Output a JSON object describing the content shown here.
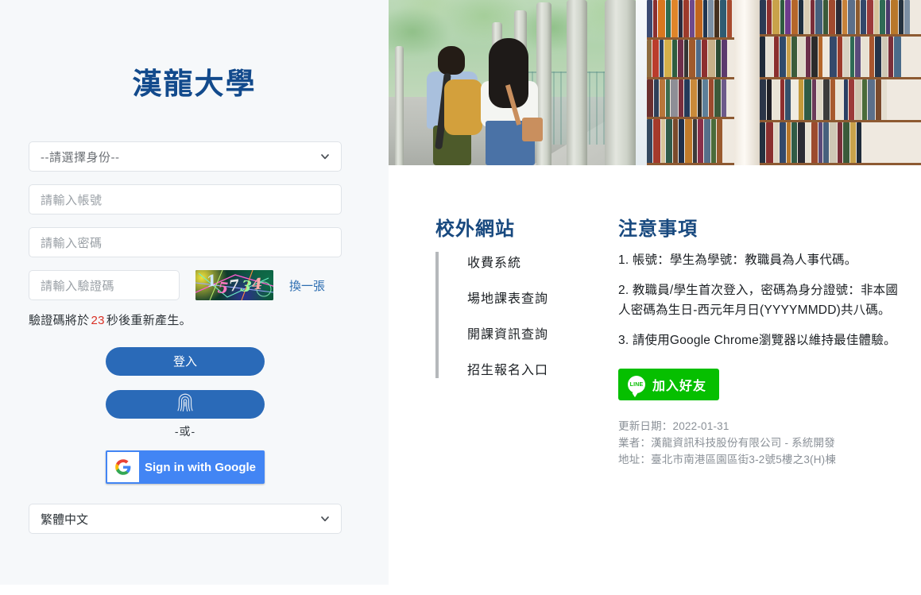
{
  "brand": {
    "title": "漢龍大學"
  },
  "login_form": {
    "identity_select": {
      "value": "--請選擇身份--",
      "icon": "chevron-down-icon"
    },
    "username_placeholder": "請輸入帳號",
    "password_placeholder": "請輸入密碼",
    "captcha_placeholder": "請輸入驗證碼",
    "captcha_code": "15734",
    "refresh_captcha_label": "換一張",
    "countdown_prefix": "驗證碼將於",
    "countdown_seconds": "23",
    "countdown_suffix": "秒後重新產生。",
    "login_button_label": "登入",
    "biometric_icon": "fingerprint-icon",
    "or_divider": "-或-",
    "google_button_label": "Sign in with Google",
    "google_icon": "google-g-icon",
    "language_select": {
      "value": "繁體中文",
      "icon": "chevron-down-icon"
    }
  },
  "banner": {
    "image_left": "campus-students-walking-photo",
    "image_right": "library-bookshelves-photo"
  },
  "external_links": {
    "title": "校外網站",
    "items": [
      {
        "label": "收費系統"
      },
      {
        "label": "場地課表查詢"
      },
      {
        "label": "開課資訊查詢"
      },
      {
        "label": "招生報名入口"
      }
    ]
  },
  "notices": {
    "title": "注意事項",
    "items": [
      "1. 帳號：學生為學號：教職員為人事代碼。",
      "2. 教職員/學生首次登入，密碼為身分證號：非本國人密碼為生日-西元年月日(YYYYMMDD)共八碼。",
      "3. 請使用Google Chrome瀏覽器以維持最佳體驗。"
    ],
    "line_button": {
      "label": "加入好友",
      "badge": "LINE",
      "icon": "line-chat-icon"
    }
  },
  "footer": {
    "updated": "更新日期：2022-01-31",
    "vendor": "業者：漢龍資訊科技股份有限公司 - 系統開發",
    "address": "地址：臺北市南港區園區街3-2號5樓之3(H)棟"
  },
  "colors": {
    "brand_blue": "#124a8c",
    "section_blue": "#18497f",
    "button_blue": "#2a6ab8",
    "google_blue": "#4285f4",
    "line_green": "#06bf00",
    "countdown_red": "#d93025",
    "link_blue": "#2b6cb0",
    "panel_bg": "#f6f8fa"
  }
}
